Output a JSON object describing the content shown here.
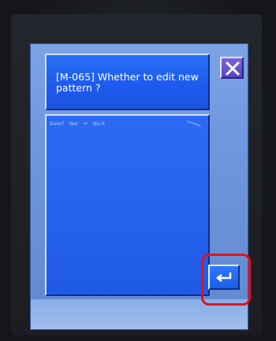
{
  "dialog": {
    "title": "[M-065] Whether to edit new pattern ?",
    "prompt": {
      "sure": "Sure?",
      "yes": "Yes:",
      "no": "No:X"
    }
  },
  "buttons": {
    "close_icon": "close-icon",
    "enter_icon": "enter-return-icon"
  },
  "colors": {
    "screen_bg": "#6f96de",
    "panel_blue": "#2563ef",
    "close_purple": "#5a47c0",
    "highlight_red": "#e0141b"
  }
}
